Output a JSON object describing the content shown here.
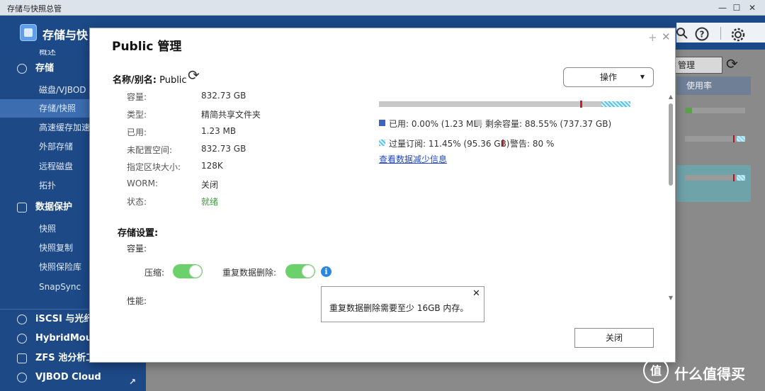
{
  "window": {
    "title": "存储与快照总管",
    "buttons": {
      "minimize": "—",
      "maximize": "☐",
      "close": "✕"
    }
  },
  "app": {
    "title": "存储与快",
    "icons": [
      "search-icon",
      "help-icon",
      "settings-icon"
    ]
  },
  "sidebar": {
    "items": [
      {
        "label": "概述",
        "type": "sub"
      },
      {
        "label": "存储",
        "type": "head",
        "icon": "storage-icon"
      },
      {
        "label": "磁盘/VJBOD",
        "type": "sub"
      },
      {
        "label": "存储/快照",
        "type": "sub",
        "active": true
      },
      {
        "label": "高速缓存加速",
        "type": "sub"
      },
      {
        "label": "外部存储",
        "type": "sub"
      },
      {
        "label": "远程磁盘",
        "type": "sub"
      },
      {
        "label": "拓扑",
        "type": "sub"
      },
      {
        "label": "数据保护",
        "type": "head",
        "icon": "data-protection-icon"
      },
      {
        "label": "快照",
        "type": "sub"
      },
      {
        "label": "快照复制",
        "type": "sub"
      },
      {
        "label": "快照保险库",
        "type": "sub"
      },
      {
        "label": "SnapSync",
        "type": "sub"
      },
      {
        "label": "iSCSI 与光纤",
        "type": "head",
        "icon": "iscsi-icon"
      },
      {
        "label": "HybridMount",
        "type": "head",
        "icon": "hybridmount-icon"
      },
      {
        "label": "ZFS 池分析工",
        "type": "head",
        "icon": "zfs-icon"
      },
      {
        "label": "VJBOD Cloud",
        "type": "head",
        "icon": "cloud-icon",
        "external": true
      }
    ]
  },
  "background": {
    "field_value": "管理",
    "column_header": "使用率"
  },
  "dialog": {
    "title": "Public  管理",
    "name_label": "名称/别名:",
    "name_value": "Public",
    "operations_button": "操作",
    "details": [
      {
        "key": "容量:",
        "value": "832.73 GB"
      },
      {
        "key": "类型:",
        "value": "精简共享文件夹"
      },
      {
        "key": "已用:",
        "value": "1.23 MB"
      },
      {
        "key": "未配置空间:",
        "value": "832.73 GB"
      },
      {
        "key": "指定区块大小:",
        "value": "128K"
      },
      {
        "key": "WORM:",
        "value": "关闭"
      },
      {
        "key": "状态:",
        "value": "就绪",
        "status": "ok"
      }
    ],
    "capacity": {
      "used_pct": 0.0,
      "free_pct": 88.55,
      "overprov_pct": 11.45,
      "warning_pct": 80,
      "legend": {
        "used": "已用: 0.00% (1.23 MB)",
        "free": "剩余容量: 88.55% (737.37 GB)",
        "overprov": "过量订阅: 11.45% (95.36 GB)",
        "warning": "警告: 80 %"
      },
      "colors": {
        "used": "#3c64c0",
        "free": "#c8c8c8",
        "warning": "#d11b24",
        "overprov": "#58c4ec"
      }
    },
    "dedup_link": "查看数据减少信息",
    "settings": {
      "title": "存储设置:",
      "capacity_label": "容量:",
      "compression_label": "压缩:",
      "compression_on": true,
      "dedup_label": "重复数据删除:",
      "dedup_on": true,
      "performance_label": "性能:"
    },
    "tooltip": {
      "text": "重复数据删除需要至少 16GB 内存。"
    },
    "close_button": "关闭"
  },
  "watermark": {
    "text": "什么值得买",
    "logo_text": "值"
  }
}
